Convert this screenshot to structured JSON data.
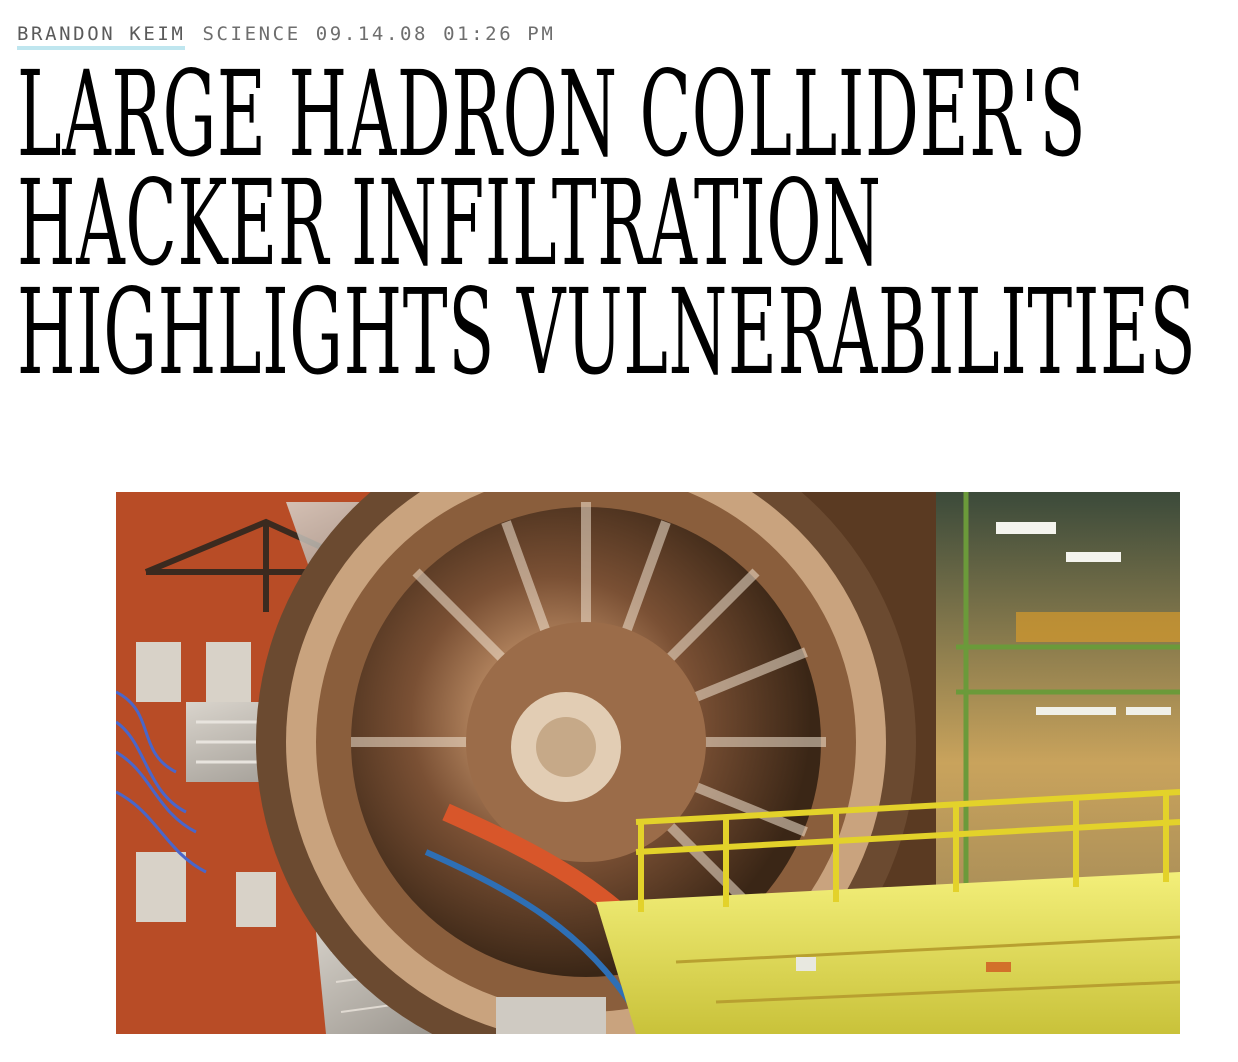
{
  "byline": {
    "author": "BRANDON KEIM",
    "section": "SCIENCE",
    "date": "09.14.08",
    "time": "01:26 PM"
  },
  "headline": {
    "lines": [
      "Large Hadron Collider's",
      "Hacker Infiltration",
      "Highlights Vulnerabilities"
    ]
  },
  "hero_image": {
    "subject": "particle-detector-photo"
  },
  "colors": {
    "author_underline": "#bfe6ef",
    "byline_text": "#6e6e6e",
    "headline_text": "#000000"
  }
}
